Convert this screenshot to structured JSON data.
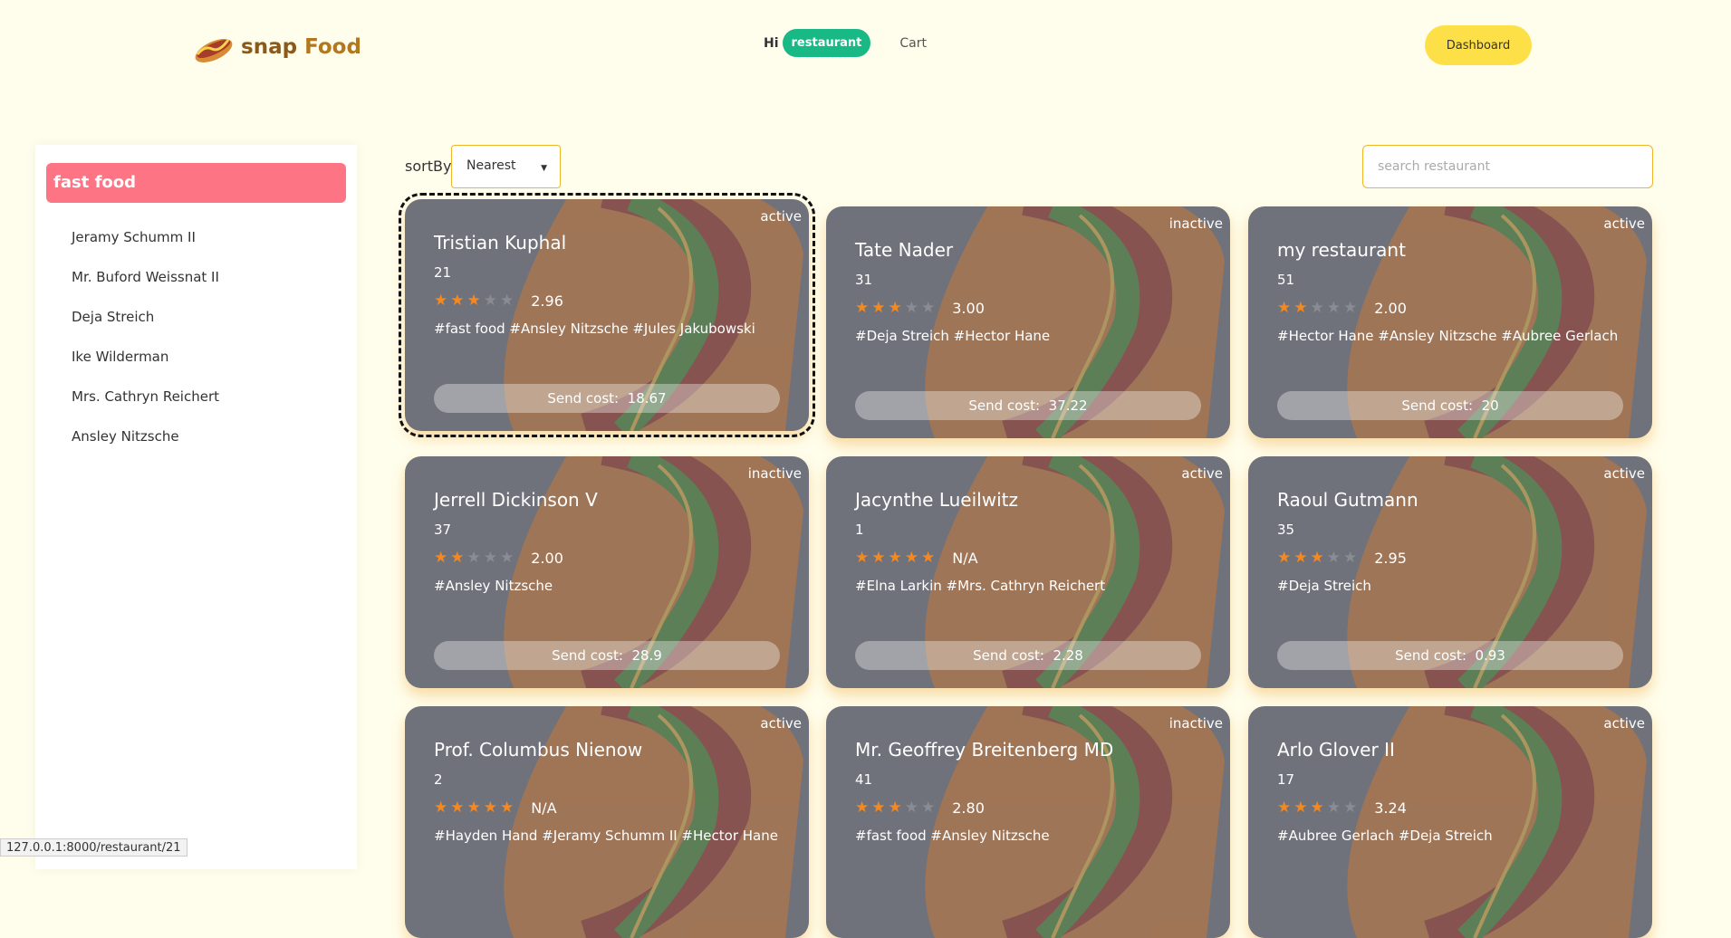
{
  "header": {
    "logo_text_1": "snap",
    "logo_text_2": "Food",
    "greeting": "Hi",
    "user": "restaurant",
    "cart": "Cart",
    "dashboard": "Dashboard"
  },
  "sidebar": {
    "active": "fast food",
    "items": [
      "Jeramy Schumm II",
      "Mr. Buford Weissnat II",
      "Deja Streich",
      "Ike Wilderman",
      "Mrs. Cathryn Reichert",
      "Ansley Nitzsche"
    ]
  },
  "toolbar": {
    "sort_label": "sortBy",
    "sort_value": "Nearest",
    "search_placeholder": "search restaurant"
  },
  "send_cost_label": "Send cost:",
  "cards": [
    {
      "name": "Tristian Kuphal",
      "count": "21",
      "stars": 3,
      "rating": "2.96",
      "status": "active",
      "tags": "#fast food #Ansley Nitzsche #Jules Jakubowski",
      "send_cost": "18.67"
    },
    {
      "name": "Tate Nader",
      "count": "31",
      "stars": 3,
      "rating": "3.00",
      "status": "inactive",
      "tags": "#Deja Streich #Hector Hane",
      "send_cost": "37.22"
    },
    {
      "name": "my restaurant",
      "count": "51",
      "stars": 2,
      "rating": "2.00",
      "status": "active",
      "tags": "#Hector Hane #Ansley Nitzsche #Aubree Gerlach",
      "send_cost": "20"
    },
    {
      "name": "Jerrell Dickinson V",
      "count": "37",
      "stars": 2,
      "rating": "2.00",
      "status": "inactive",
      "tags": "#Ansley Nitzsche",
      "send_cost": "28.9"
    },
    {
      "name": "Jacynthe Lueilwitz",
      "count": "1",
      "stars": 5,
      "rating": "N/A",
      "status": "active",
      "tags": "#Elna Larkin #Mrs. Cathryn Reichert",
      "send_cost": "2.28"
    },
    {
      "name": "Raoul Gutmann",
      "count": "35",
      "stars": 3,
      "rating": "2.95",
      "status": "active",
      "tags": "#Deja Streich",
      "send_cost": "0.93"
    },
    {
      "name": "Prof. Columbus Nienow",
      "count": "2",
      "stars": 5,
      "rating": "N/A",
      "status": "active",
      "tags": "#Hayden Hand #Jeramy Schumm II #Hector Hane",
      "send_cost": ""
    },
    {
      "name": "Mr. Geoffrey Breitenberg MD",
      "count": "41",
      "stars": 3,
      "rating": "2.80",
      "status": "inactive",
      "tags": "#fast food #Ansley Nitzsche",
      "send_cost": ""
    },
    {
      "name": "Arlo Glover II",
      "count": "17",
      "stars": 3,
      "rating": "3.24",
      "status": "active",
      "tags": "#Aubree Gerlach #Deja Streich",
      "send_cost": ""
    }
  ],
  "status_bar": "127.0.0.1:8000/restaurant/21"
}
